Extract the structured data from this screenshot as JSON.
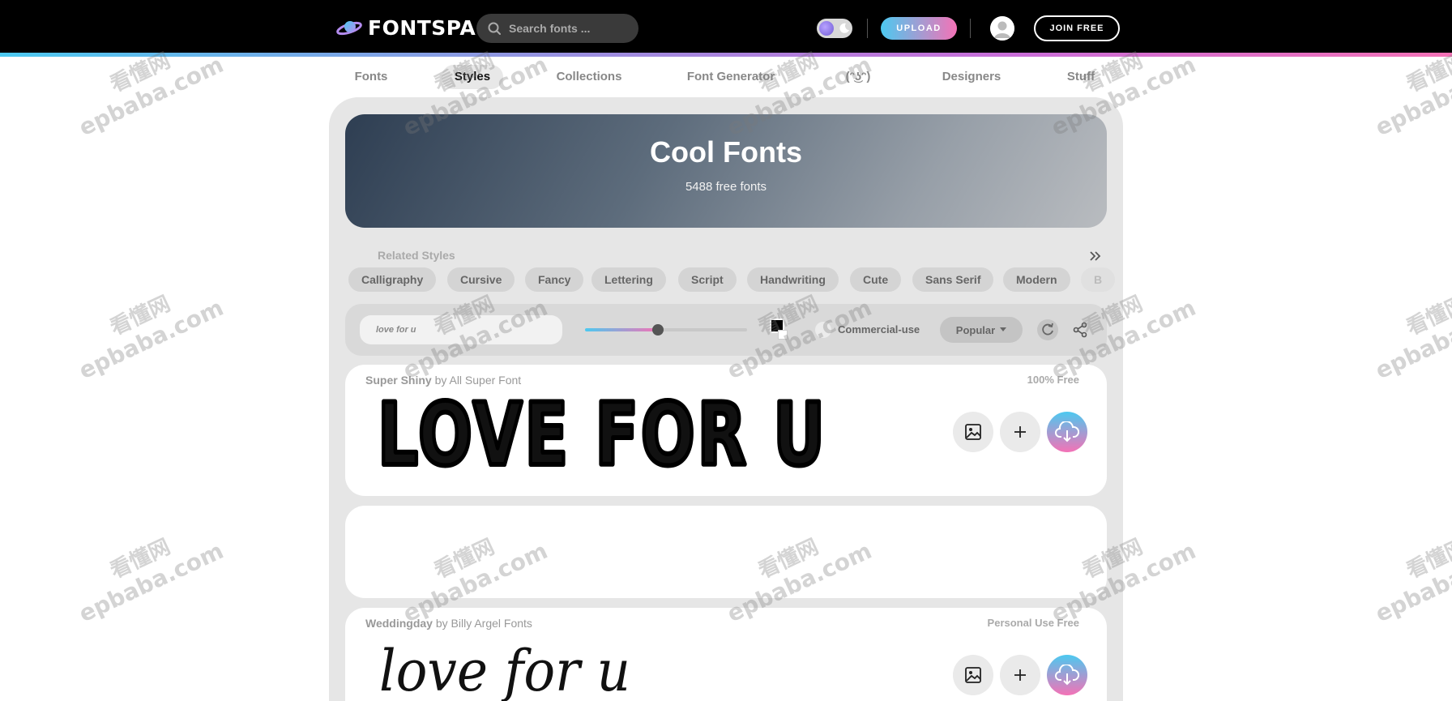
{
  "header": {
    "logo_text": "FONTSPACE",
    "search_placeholder": "Search fonts ...",
    "upload_label": "UPLOAD",
    "join_label": "JOIN FREE"
  },
  "nav": {
    "items": [
      {
        "label": "Fonts"
      },
      {
        "label": "Styles"
      },
      {
        "label": "Collections"
      },
      {
        "label": "Font Generator"
      },
      {
        "label": "(ᵔ͜ʖᵔ)"
      },
      {
        "label": "Designers"
      },
      {
        "label": "Stuff"
      }
    ],
    "active": "Styles"
  },
  "hero": {
    "title": "Cool Fonts",
    "subtitle": "5488 free fonts"
  },
  "related": {
    "label": "Related Styles",
    "chips": [
      "Calligraphy",
      "Cursive",
      "Fancy",
      "Lettering",
      "Script",
      "Handwriting",
      "Cute",
      "Sans Serif",
      "Modern",
      "B"
    ]
  },
  "controls": {
    "preview_text": "love for u",
    "size_slider_level": 0.45,
    "color": "#000000",
    "commercial_label": "Commercial-use",
    "sort_label": "Popular"
  },
  "cards": [
    {
      "font_name": "Super Shiny",
      "by_label": " by ",
      "designer": "All Super Font",
      "license": "100% Free",
      "preview_text": "LOVE FOR U"
    },
    {
      "font_name": "Weddingday",
      "by_label": " by ",
      "designer": "Billy Argel Fonts",
      "license": "Personal Use Free",
      "preview_text": "love for u"
    }
  ],
  "watermark": {
    "cn": "看懂网",
    "en": "epbaba.com"
  },
  "colors": {
    "topbar": "#000000",
    "accent_start": "#4cc9f0",
    "accent_end": "#f472b6",
    "panel": "#e6e6e6"
  },
  "icons": [
    "logo-planet-icon",
    "search-icon",
    "moon-icon",
    "avatar-icon",
    "chevron-double-right-icon",
    "refresh-icon",
    "share-icon",
    "image-icon",
    "plus-icon",
    "cloud-download-icon",
    "caret-down-icon"
  ]
}
